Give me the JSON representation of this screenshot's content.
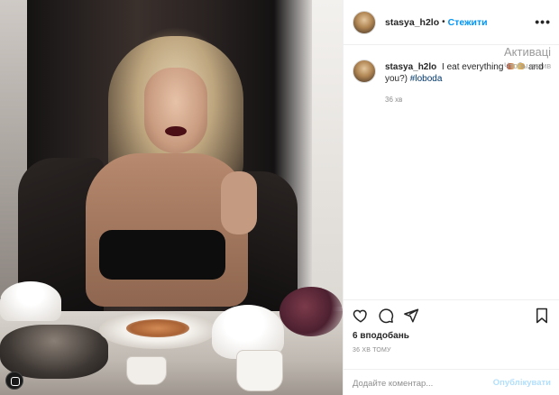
{
  "post": {
    "username": "stasya_h2lo",
    "dot": "•",
    "follow_label": "Стежити",
    "more_label": "•••"
  },
  "caption": {
    "username": "stasya_h2lo",
    "text_before": "I eat everything",
    "text_after": "and you?)",
    "hashtag": "#loboda",
    "time": "36 хв",
    "emoji_icons": [
      "pizza-icon",
      "cheese-icon"
    ]
  },
  "actions": {
    "icons": [
      "heart-icon",
      "comment-icon",
      "share-icon",
      "bookmark-icon"
    ],
    "likes": "6 вподобань",
    "posted_ago": "36 ХВ ТОМУ"
  },
  "comment": {
    "placeholder": "Додайте коментар...",
    "publish_label": "Опублікувати"
  },
  "watermark": {
    "title": "Активаці",
    "subtitle": "Чтобы актив"
  },
  "colors": {
    "link_blue": "#0095f6",
    "publish_disabled": "#b2dffc"
  }
}
